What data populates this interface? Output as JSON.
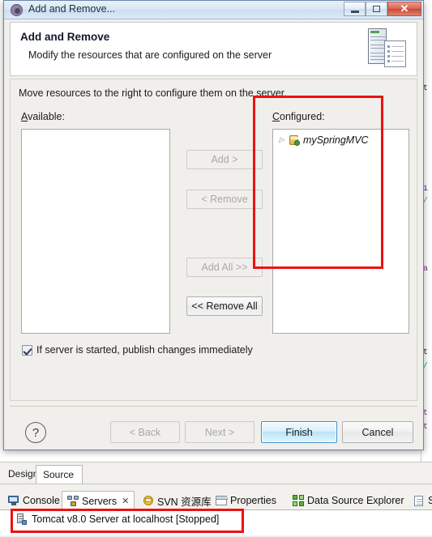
{
  "window": {
    "title": "Add and Remove...",
    "icon": "settings-gear-icon",
    "minimize_label": "Minimize",
    "restore_label": "Restore",
    "close_label": "✕"
  },
  "banner": {
    "title": "Add and Remove",
    "subtitle": "Modify the resources that are configured on the server",
    "icon": "server-and-document-icon"
  },
  "body": {
    "hint": "Move resources to the right to configure them on the server.",
    "available_label": "Available:",
    "configured_label": "Configured:",
    "available_items": [],
    "configured_items": [
      {
        "label": "mySpringMVC",
        "icon": "project-module-icon",
        "expander": "▷",
        "expanded": false
      }
    ],
    "buttons": [
      {
        "id": "add",
        "label": "Add >",
        "enabled": false
      },
      {
        "id": "remove",
        "label": "< Remove",
        "enabled": false
      },
      {
        "id": "add-all",
        "label": "Add All >>",
        "enabled": false
      },
      {
        "id": "remove-all",
        "label": "<< Remove All",
        "enabled": true
      }
    ],
    "publish_checkbox": {
      "label": "If server is started, publish changes immediately",
      "checked": true
    }
  },
  "footer": {
    "help_label": "?",
    "back_label": "< Back",
    "back_enabled": false,
    "next_label": "Next >",
    "next_enabled": false,
    "finish_label": "Finish",
    "finish_enabled": true,
    "finish_default": true,
    "cancel_label": "Cancel",
    "cancel_enabled": true
  },
  "ide": {
    "design_source_tabs": [
      {
        "label": "Design",
        "active": false
      },
      {
        "label": "Source",
        "active": true
      }
    ],
    "view_tabs": [
      {
        "label": "Console",
        "icon": "console-icon",
        "active": false,
        "closable": false
      },
      {
        "label": "Servers",
        "icon": "servers-icon",
        "active": true,
        "closable": true,
        "close_glyph": "✕"
      },
      {
        "label": "SVN 资源库",
        "icon": "svn-repository-icon",
        "active": false,
        "closable": false
      },
      {
        "label": "Properties",
        "icon": "properties-icon",
        "active": false,
        "closable": false
      },
      {
        "label": "Data Source Explorer",
        "icon": "data-source-explorer-icon",
        "active": false,
        "closable": false
      },
      {
        "label": "Sn",
        "icon": "snippets-icon",
        "active": false,
        "closable": false
      }
    ],
    "servers_view": {
      "rows": [
        {
          "label": "Tomcat v8.0 Server at localhost  [Stopped]",
          "icon": "tomcat-server-icon"
        }
      ]
    },
    "editor_code": [
      {
        "text": "i",
        "color": "blue"
      },
      {
        "text": "/",
        "color": "teal"
      },
      {
        "text": "a",
        "color": "purple"
      },
      {
        "text": "t",
        "color": "dark"
      },
      {
        "text": "/",
        "color": "teal"
      },
      {
        "text": "t",
        "color": "purple"
      },
      {
        "text": "t",
        "color": "purple"
      }
    ]
  },
  "annotations": {
    "color": "#ee1111",
    "boxes": [
      {
        "id": "configured-panel-highlight",
        "target": "configured-list"
      },
      {
        "id": "tomcat-server-row-highlight",
        "target": "server-row"
      }
    ]
  }
}
